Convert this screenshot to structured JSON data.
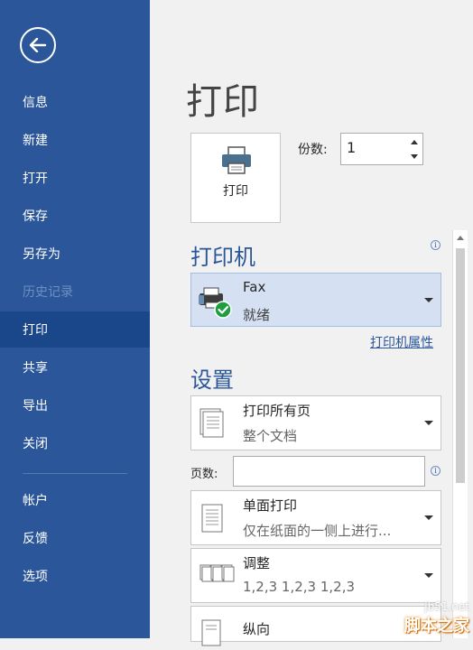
{
  "sidebar": {
    "items": [
      {
        "label": "信息"
      },
      {
        "label": "新建"
      },
      {
        "label": "打开"
      },
      {
        "label": "保存"
      },
      {
        "label": "另存为"
      },
      {
        "label": "历史记录"
      },
      {
        "label": "打印"
      },
      {
        "label": "共享"
      },
      {
        "label": "导出"
      },
      {
        "label": "关闭"
      },
      {
        "label": "帐户"
      },
      {
        "label": "反馈"
      },
      {
        "label": "选项"
      }
    ],
    "active": "打印",
    "disabled": "历史记录"
  },
  "main": {
    "title": "打印",
    "print_button_label": "打印",
    "copies_label": "份数:",
    "copies_value": "1",
    "printer_heading": "打印机",
    "printer": {
      "name": "Fax",
      "status": "就绪"
    },
    "printer_properties": "打印机属性",
    "settings_heading": "设置",
    "pages_label": "页数:",
    "settings": [
      {
        "line1": "打印所有页",
        "line2": "整个文档"
      },
      {
        "line1": "单面打印",
        "line2": "仅在纸面的一侧上进行..."
      },
      {
        "line1": "调整",
        "line2": "1,2,3    1,2,3    1,2,3"
      },
      {
        "line1": "纵向",
        "line2": ""
      }
    ]
  },
  "watermark": {
    "line1": "jb51.net",
    "line2": "脚本之家"
  },
  "colors": {
    "sidebar": "#2b579a",
    "active_item": "#19478a",
    "accent": "#2b579a",
    "printer_selected": "#d5e1f2"
  }
}
